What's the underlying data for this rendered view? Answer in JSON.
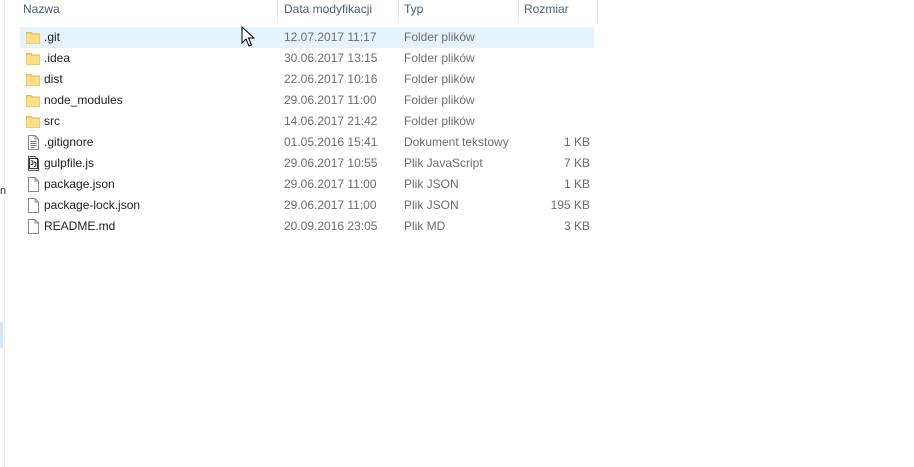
{
  "columns": {
    "name": "Nazwa",
    "date": "Data modyfikacji",
    "type": "Typ",
    "size": "Rozmiar"
  },
  "nav_fragment": "n",
  "files": [
    {
      "name": ".git",
      "date": "12.07.2017 11:17",
      "type": "Folder plików",
      "size": "",
      "icon": "folder-icon",
      "selected": true
    },
    {
      "name": ".idea",
      "date": "30.06.2017 13:15",
      "type": "Folder plików",
      "size": "",
      "icon": "folder-icon"
    },
    {
      "name": "dist",
      "date": "22.06.2017 10:16",
      "type": "Folder plików",
      "size": "",
      "icon": "folder-icon"
    },
    {
      "name": "node_modules",
      "date": "29.06.2017 11:00",
      "type": "Folder plików",
      "size": "",
      "icon": "folder-icon"
    },
    {
      "name": "src",
      "date": "14.06.2017 21:42",
      "type": "Folder plików",
      "size": "",
      "icon": "folder-icon"
    },
    {
      "name": ".gitignore",
      "date": "01.05.2016 15:41",
      "type": "Dokument tekstowy",
      "size": "1 KB",
      "icon": "text-file-icon"
    },
    {
      "name": "gulpfile.js",
      "date": "29.06.2017 10:55",
      "type": "Plik JavaScript",
      "size": "7 KB",
      "icon": "script-file-icon"
    },
    {
      "name": "package.json",
      "date": "29.06.2017 11:00",
      "type": "Plik JSON",
      "size": "1 KB",
      "icon": "file-icon"
    },
    {
      "name": "package-lock.json",
      "date": "29.06.2017 11:00",
      "type": "Plik JSON",
      "size": "195 KB",
      "icon": "file-icon"
    },
    {
      "name": "README.md",
      "date": "20.09.2016 23:05",
      "type": "Plik MD",
      "size": "3 KB",
      "icon": "file-icon"
    }
  ],
  "colors": {
    "header_text": "#4c607a",
    "selection": "#e5f3ff",
    "folder": "#ffd76e",
    "folder_dark": "#e8b84a"
  }
}
